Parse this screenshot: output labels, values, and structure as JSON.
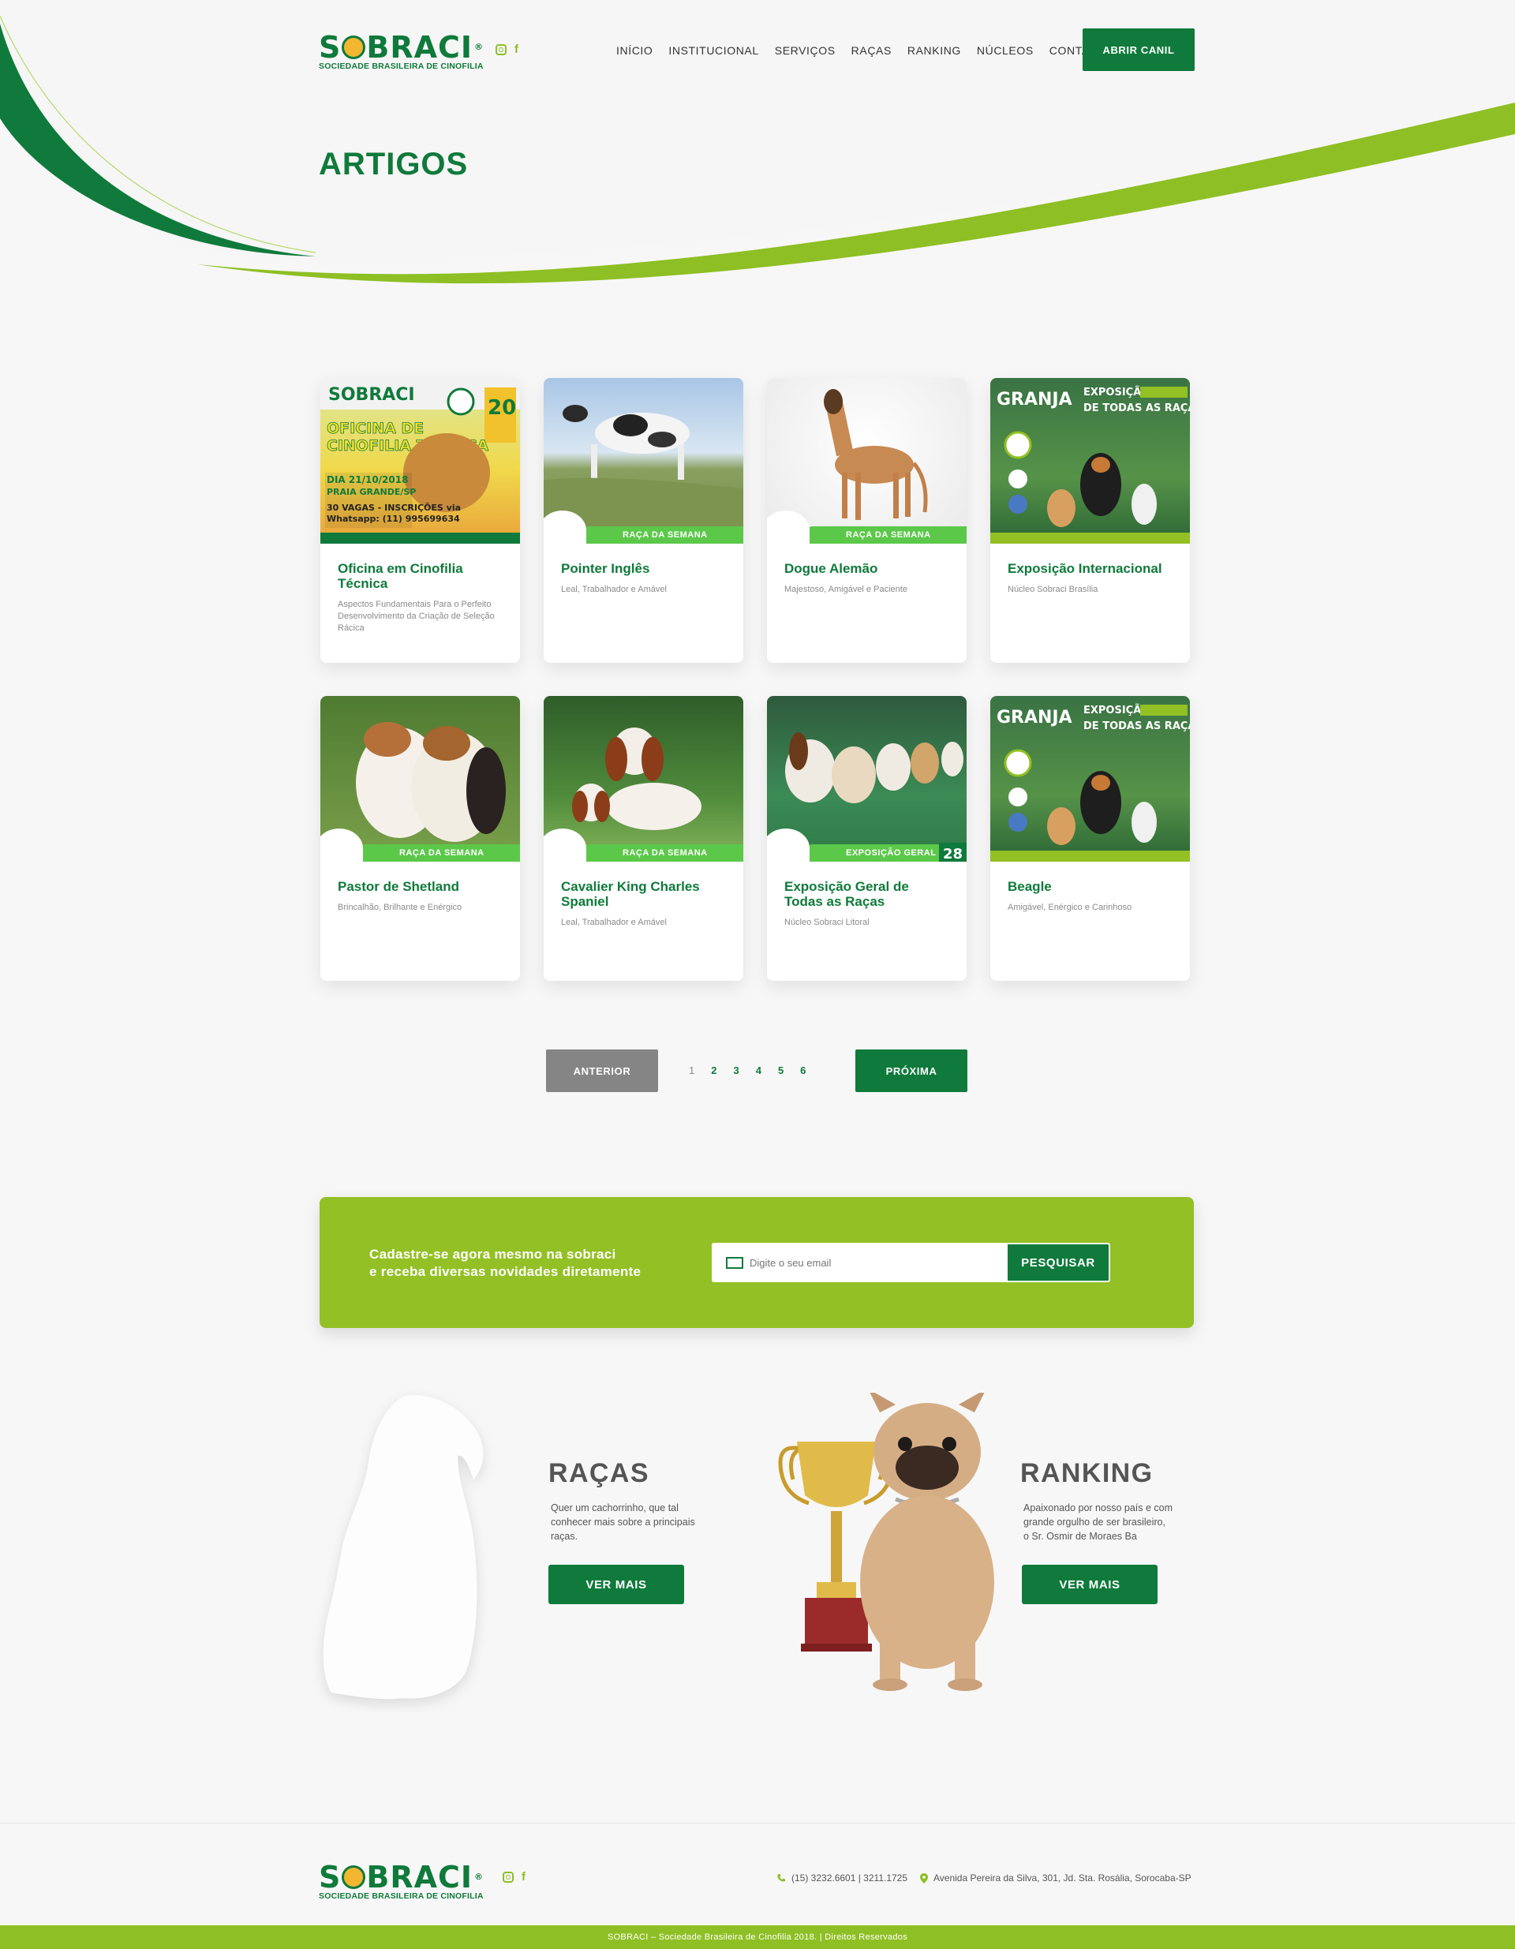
{
  "header": {
    "logo_word": "SOBRACI",
    "logo_word_start": "S",
    "logo_word_end": "BRACI",
    "logo_sub": "SOCIEDADE BRASILEIRA DE CINOFILIA",
    "nav": [
      "INÍCIO",
      "INSTITUCIONAL",
      "SERVIÇOS",
      "RAÇAS",
      "RANKING",
      "NÚCLEOS",
      "CONTATO"
    ],
    "cta": "ABRIR CANIL",
    "social": [
      "instagram-icon",
      "facebook-icon"
    ]
  },
  "page_title": "ARTIGOS",
  "articles": [
    {
      "title": "Oficina em Cinofilia Técnica",
      "subtitle": "Aspectos Fundamentais Para o Perfeito Desenvolvimento da Criação de Seleção Rácica",
      "image": "oficina-de-cinofilia-tecnica-flyer"
    },
    {
      "title": "Pointer Inglês",
      "subtitle": "Leal, Trabalhador e Amável",
      "image": "pointer-dog-photo",
      "tag": "RAÇA DA SEMANA"
    },
    {
      "title": "Dogue Alemão",
      "subtitle": "Majestoso, Amigável e Paciente",
      "image": "great-dane-photo",
      "tag": "RAÇA DA SEMANA"
    },
    {
      "title": "Exposição Internacional",
      "subtitle": "Núcleo Sobraci Brasília",
      "image": "granja-exposicao-poster"
    },
    {
      "title": "Pastor de Shetland",
      "subtitle": "Brincalhão, Brilhante e Enérgico",
      "image": "shetland-sheepdog-photo",
      "tag": "RAÇA DA SEMANA"
    },
    {
      "title": "Cavalier King Charles Spaniel",
      "subtitle": "Leal, Trabalhador e Amável",
      "image": "cavalier-spaniel-photo",
      "tag": "RAÇA DA SEMANA"
    },
    {
      "title": "Exposição Geral de Todas as Raças",
      "subtitle": "Núcleo Sobraci Litoral",
      "image": "beagles-show-photo",
      "tag": "EXPOSIÇÃO GERAL"
    },
    {
      "title": "Beagle",
      "subtitle": "Amigável, Enérgico e Carinhoso",
      "image": "granja-exposicao-poster"
    }
  ],
  "pagination": {
    "prev": "ANTERIOR",
    "next": "PRÓXIMA",
    "pages": [
      "1",
      "2",
      "3",
      "4",
      "5",
      "6"
    ],
    "current": "1"
  },
  "newsletter": {
    "line1": "Cadastre-se agora mesmo na sobraci",
    "line2": "e receba diversas novidades diretamente",
    "placeholder": "Digite o seu email",
    "button": "PESQUISAR"
  },
  "promo": {
    "racas": {
      "title": "RAÇAS",
      "text_lines": [
        "Quer um cachorrinho, que tal",
        "conhecer mais sobre a principais",
        "raças."
      ],
      "button": "VER MAIS"
    },
    "ranking": {
      "title": "RANKING",
      "text_lines": [
        "Apaixonado por nosso país e com",
        "grande orgulho de ser brasileiro,",
        "o Sr. Osmir de Moraes Ba"
      ],
      "button": "VER MAIS"
    }
  },
  "footer": {
    "phone": "(15) 3232.6601 | 3211.1725",
    "address": "Avenida Pereira da Silva, 301, Jd. Sta. Rosália, Sorocaba-SP",
    "copyright": "SOBRACI – Sociedade Brasileira de Cinofilia 2018. | Direitos Reservados"
  },
  "colors": {
    "primary": "#0f7a3b",
    "accent": "#93c025",
    "tag_green": "#5cc84a",
    "button_grey": "#858585"
  }
}
